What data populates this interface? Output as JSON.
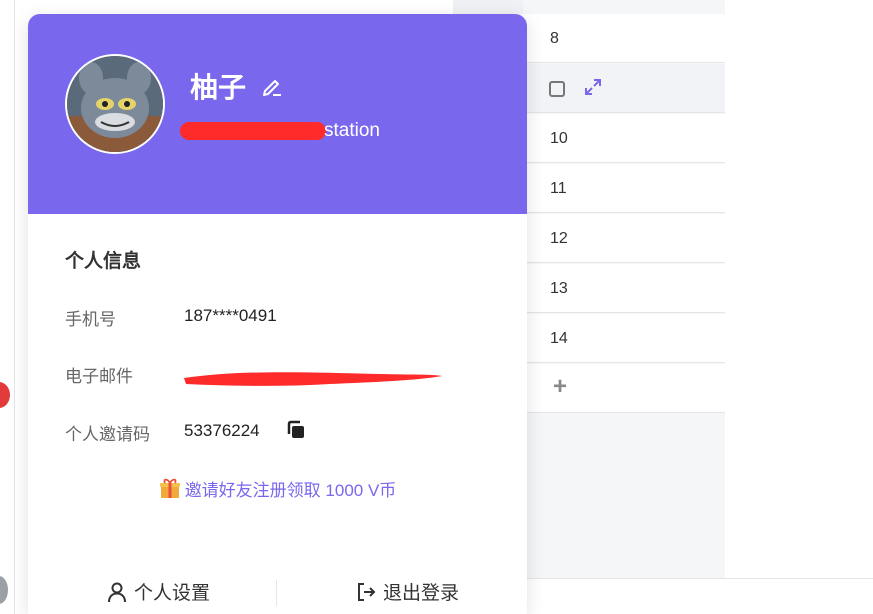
{
  "profile": {
    "username": "柚子",
    "subtitle_suffix": "station"
  },
  "info": {
    "section_title": "个人信息",
    "phone_label": "手机号",
    "phone_value": "187****0491",
    "email_label": "电子邮件",
    "invite_code_label": "个人邀请码",
    "invite_code_value": "53376224"
  },
  "invite_link": "邀请好友注册领取 1000 V币",
  "footer": {
    "settings_label": "个人设置",
    "logout_label": "退出登录"
  },
  "table": {
    "rows": [
      "8",
      "",
      "10",
      "11",
      "12",
      "13",
      "14"
    ]
  },
  "colors": {
    "header_bg": "#7967ee",
    "accent": "#7967ee",
    "redaction": "#ff2a2a"
  },
  "icons": [
    "edit-icon",
    "copy-icon",
    "gift-icon",
    "user-icon",
    "logout-icon",
    "expand-icon",
    "plus-icon",
    "checkbox-icon"
  ]
}
